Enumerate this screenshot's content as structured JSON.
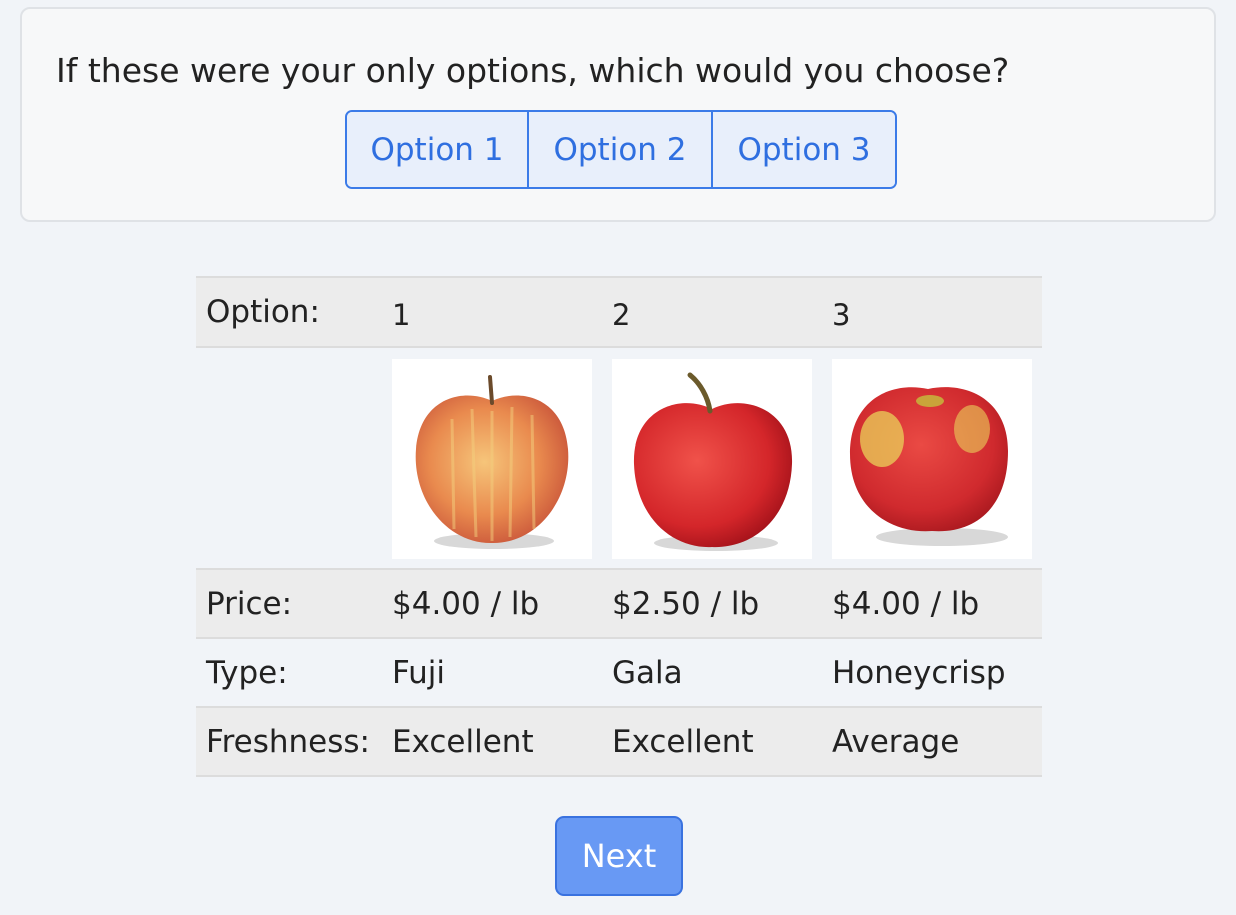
{
  "question": {
    "text": "If these were your only options, which would you choose?",
    "choices": [
      "Option 1",
      "Option 2",
      "Option 3"
    ]
  },
  "table": {
    "header_label": "Option:",
    "option_numbers": [
      "1",
      "2",
      "3"
    ],
    "images": [
      "fuji-apple-image",
      "gala-apple-image",
      "honeycrisp-apple-image"
    ],
    "rows": [
      {
        "label": "Price:",
        "values": [
          "$4.00 / lb",
          "$2.50 / lb",
          "$4.00 / lb"
        ]
      },
      {
        "label": "Type:",
        "values": [
          "Fuji",
          "Gala",
          "Honeycrisp"
        ]
      },
      {
        "label": "Freshness:",
        "values": [
          "Excellent",
          "Excellent",
          "Average"
        ]
      }
    ]
  },
  "next_label": "Next",
  "colors": {
    "accent": "#3b7be8",
    "choice_bg": "#e8effb",
    "next_bg": "#6899f4",
    "page_bg": "#f1f4f8",
    "row_shade": "#ececec"
  }
}
